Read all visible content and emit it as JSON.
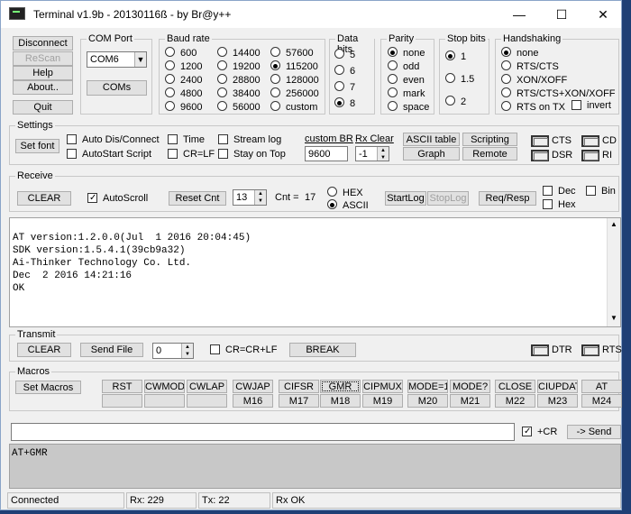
{
  "window": {
    "title": "Terminal v1.9b - 20130116ß - by Br@y++",
    "min": "—",
    "max": "☐",
    "close": "✕"
  },
  "left_buttons": [
    "Disconnect",
    "ReScan",
    "Help",
    "About..",
    "Quit"
  ],
  "com_port": {
    "label": "COM Port",
    "value": "COM6",
    "coms": "COMs"
  },
  "baud": {
    "label": "Baud rate",
    "options": [
      "600",
      "1200",
      "2400",
      "4800",
      "9600",
      "14400",
      "19200",
      "28800",
      "38400",
      "56000",
      "57600",
      "115200",
      "128000",
      "256000",
      "custom"
    ],
    "selected": "115200"
  },
  "data_bits": {
    "label": "Data bits",
    "options": [
      "5",
      "6",
      "7",
      "8"
    ],
    "selected": "8"
  },
  "parity": {
    "label": "Parity",
    "options": [
      "none",
      "odd",
      "even",
      "mark",
      "space"
    ],
    "selected": "none"
  },
  "stop_bits": {
    "label": "Stop bits",
    "options": [
      "1",
      "1.5",
      "2"
    ],
    "selected": "1"
  },
  "handshaking": {
    "label": "Handshaking",
    "options": [
      "none",
      "RTS/CTS",
      "XON/XOFF",
      "RTS/CTS+XON/XOFF",
      "RTS on TX"
    ],
    "selected": "none",
    "invert": "invert"
  },
  "settings": {
    "label": "Settings",
    "set_font": "Set font",
    "checks": [
      "Auto Dis/Connect",
      "AutoStart Script",
      "Time",
      "CR=LF",
      "Stream log",
      "Stay on Top"
    ],
    "custom_br_label": "custom BR",
    "custom_br_value": "9600",
    "rx_clear_label": "Rx Clear",
    "rx_clear_value": "-1",
    "ascii_table": "ASCII table",
    "graph": "Graph",
    "scripting": "Scripting",
    "remote": "Remote",
    "lamps": [
      "CTS",
      "CD",
      "DSR",
      "RI"
    ]
  },
  "receive": {
    "label": "Receive",
    "clear": "CLEAR",
    "autoscroll": "AutoScroll",
    "reset_cnt": "Reset Cnt",
    "cnt_value": "13",
    "cnt_label": "Cnt =",
    "cnt": "17",
    "hex": "HEX",
    "ascii": "ASCII",
    "start_log": "StartLog",
    "stop_log": "StopLog",
    "req_resp": "Req/Resp",
    "dec": "Dec",
    "bin": "Bin",
    "hex_chk": "Hex"
  },
  "terminal_lines": [
    "AT version:1.2.0.0(Jul  1 2016 20:04:45)",
    "SDK version:1.5.4.1(39cb9a32)",
    "Ai-Thinker Technology Co. Ltd.",
    "Dec  2 2016 14:21:16",
    "OK"
  ],
  "transmit": {
    "label": "Transmit",
    "clear": "CLEAR",
    "send_file": "Send File",
    "value": "0",
    "crcrlf": "CR=CR+LF",
    "break": "BREAK",
    "dtr": "DTR",
    "rts": "RTS"
  },
  "macros": {
    "label": "Macros",
    "set_macros": "Set Macros",
    "top": [
      "RST",
      "CWMODE",
      "CWLAP",
      "CWJAP",
      "CIFSR",
      "GMR",
      "CIPMUX",
      "MODE=1",
      "MODE?",
      "CLOSE",
      "CIUPDAT",
      "AT"
    ],
    "bottom": [
      "",
      "",
      "",
      "M16",
      "M17",
      "M18",
      "M19",
      "M20",
      "M21",
      "M22",
      "M23",
      "M24"
    ]
  },
  "send": {
    "input": "",
    "cr": "+CR",
    "send": "-> Send"
  },
  "tx_text": "AT+GMR",
  "status": {
    "conn": "Connected",
    "rx": "Rx: 229",
    "tx": "Tx: 22",
    "rxok": "Rx OK"
  }
}
